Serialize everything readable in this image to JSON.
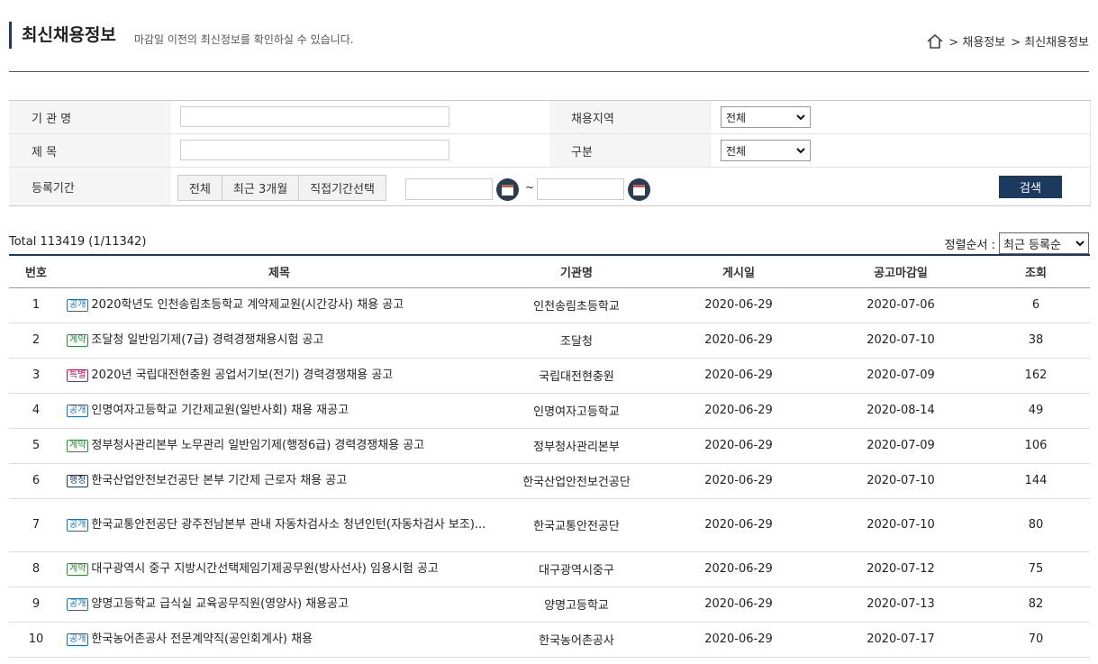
{
  "header": {
    "title": "최신채용정보",
    "subtitle": "마감일 이전의 최신정보를 확인하실 수 있습니다.",
    "breadcrumb": [
      "> 채용정보",
      "> 최신채용정보"
    ]
  },
  "search": {
    "org_label": "기 관 명",
    "title_label": "제 목",
    "period_label": "등록기간",
    "region_label": "채용지역",
    "type_label": "구분",
    "region_value": "전체",
    "type_value": "전체",
    "period_buttons": [
      "전체",
      "최근 3개월",
      "직접기간선택"
    ],
    "tilde": "~",
    "search_button": "검색"
  },
  "list": {
    "total": "Total 113419 (1/11342)",
    "sort_label": "정렬순서 :",
    "sort_value": "최근 등록순",
    "columns": [
      "번호",
      "제목",
      "기관명",
      "게시일",
      "공고마감일",
      "조회"
    ],
    "rows": [
      {
        "no": "1",
        "badge": "공개",
        "badge_color": "#1a6fb4",
        "title": "2020학년도 인천송림초등학교 계약제교원(시간강사) 채용 공고",
        "org": "인천송림초등학교",
        "posted": "2020-06-29",
        "deadline": "2020-07-06",
        "views": "6"
      },
      {
        "no": "2",
        "badge": "계약",
        "badge_color": "#2e8b3a",
        "title": "조달청 일반임기제(7급) 경력경쟁채용시험 공고",
        "org": "조달청",
        "posted": "2020-06-29",
        "deadline": "2020-07-10",
        "views": "38"
      },
      {
        "no": "3",
        "badge": "특별",
        "badge_color": "#b0175f",
        "title": "2020년 국립대전현충원 공업서기보(전기) 경력경쟁채용 공고",
        "org": "국립대전현충원",
        "posted": "2020-06-29",
        "deadline": "2020-07-09",
        "views": "162"
      },
      {
        "no": "4",
        "badge": "공개",
        "badge_color": "#1a6fb4",
        "title": "인명여자고등학교 기간제교원(일반사회) 채용 재공고",
        "org": "인명여자고등학교",
        "posted": "2020-06-29",
        "deadline": "2020-08-14",
        "views": "49"
      },
      {
        "no": "5",
        "badge": "계약",
        "badge_color": "#2e8b3a",
        "title": "정부청사관리본부 노무관리 일반임기제(행정6급) 경력경쟁채용 공고",
        "org": "정부청사관리본부",
        "posted": "2020-06-29",
        "deadline": "2020-07-09",
        "views": "106"
      },
      {
        "no": "6",
        "badge": "행정",
        "badge_color": "#1b3a5e",
        "title": "한국산업안전보건공단 본부 기간제 근로자 채용 공고",
        "org": "한국산업안전보건공단",
        "posted": "2020-06-29",
        "deadline": "2020-07-10",
        "views": "144"
      },
      {
        "no": "7",
        "badge": "공개",
        "badge_color": "#1a6fb4",
        "title": "한국교통안전공단 광주전남본부 관내 자동차검사소 청년인턴(자동차검사 보조)...",
        "org": "한국교통안전공단",
        "posted": "2020-06-29",
        "deadline": "2020-07-10",
        "views": "80"
      },
      {
        "no": "8",
        "badge": "계약",
        "badge_color": "#2e8b3a",
        "title": "대구광역시 중구 지방시간선택제임기제공무원(방사선사) 임용시험 공고",
        "org": "대구광역시중구",
        "posted": "2020-06-29",
        "deadline": "2020-07-12",
        "views": "75"
      },
      {
        "no": "9",
        "badge": "공개",
        "badge_color": "#1a6fb4",
        "title": "양명고등학교 급식실 교육공무직원(영양사) 채용공고",
        "org": "양명고등학교",
        "posted": "2020-06-29",
        "deadline": "2020-07-13",
        "views": "82"
      },
      {
        "no": "10",
        "badge": "공개",
        "badge_color": "#1a6fb4",
        "title": "한국농어촌공사 전문계약직(공인회계사) 채용",
        "org": "한국농어촌공사",
        "posted": "2020-06-29",
        "deadline": "2020-07-17",
        "views": "70"
      }
    ]
  }
}
